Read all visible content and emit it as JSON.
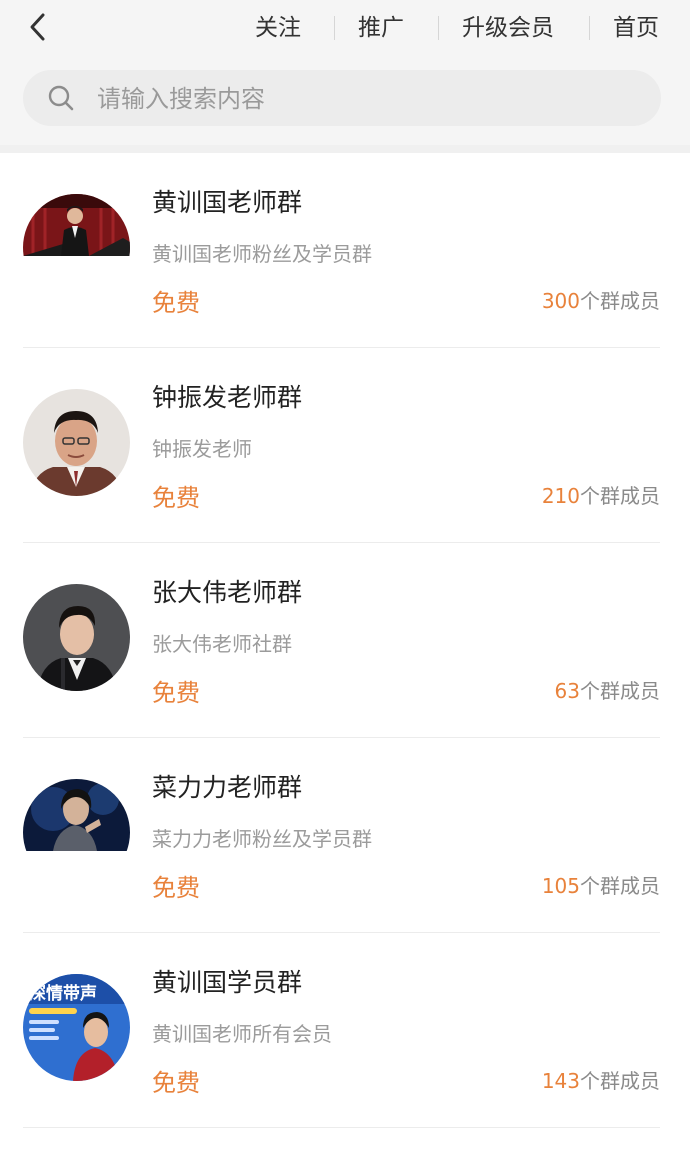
{
  "header": {
    "back_icon": "chevron-left-icon",
    "nav": [
      {
        "label": "关注"
      },
      {
        "label": "推广"
      },
      {
        "label": "升级会员"
      },
      {
        "label": "首页"
      }
    ]
  },
  "search": {
    "icon": "search-icon",
    "placeholder": "请输入搜索内容",
    "value": ""
  },
  "colors": {
    "accent": "#e8823b",
    "topbar_bg": "#f5f5f5",
    "search_bg": "#ececec"
  },
  "groups": [
    {
      "title": "黄训国老师群",
      "description": "黄训国老师粉丝及学员群",
      "price": "免费",
      "member_count": "300",
      "member_suffix": "个群成员"
    },
    {
      "title": "钟振发老师群",
      "description": "钟振发老师",
      "price": "免费",
      "member_count": "210",
      "member_suffix": "个群成员"
    },
    {
      "title": "张大伟老师群",
      "description": "张大伟老师社群",
      "price": "免费",
      "member_count": "63",
      "member_suffix": "个群成员"
    },
    {
      "title": "菜力力老师群",
      "description": "菜力力老师粉丝及学员群",
      "price": "免费",
      "member_count": "105",
      "member_suffix": "个群成员"
    },
    {
      "title": "黄训国学员群",
      "description": "黄训国老师所有会员",
      "price": "免费",
      "member_count": "143",
      "member_suffix": "个群成员"
    }
  ],
  "group_avatar_5_text": "深情带声"
}
